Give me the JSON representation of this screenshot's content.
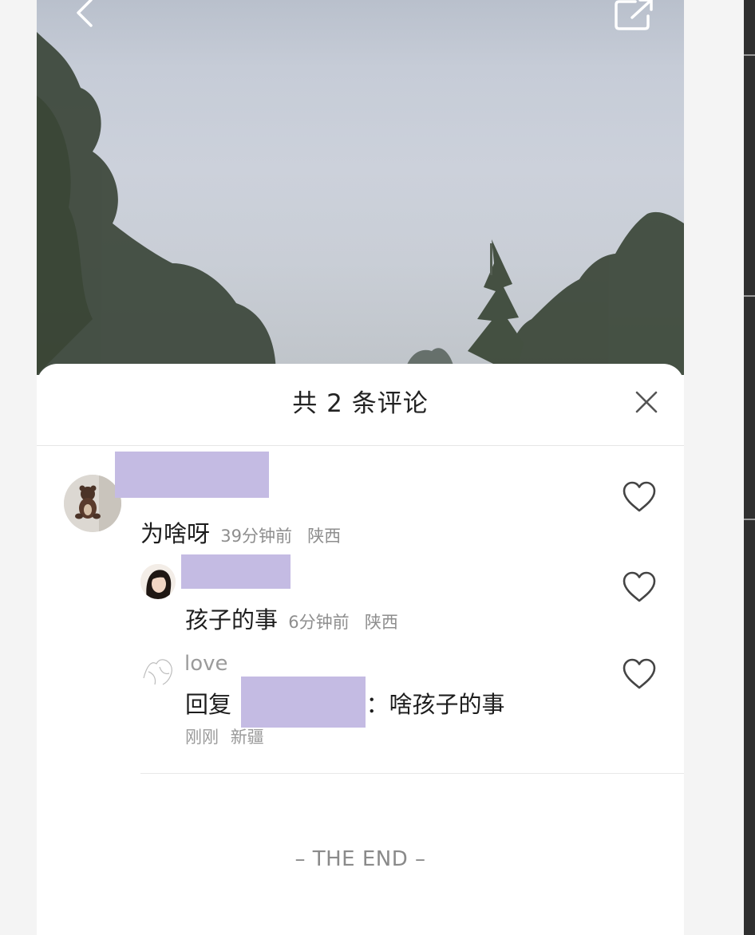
{
  "icons": {
    "back": "chevron-left-icon",
    "share": "share-external-icon",
    "close": "close-icon",
    "like": "heart-outline-icon"
  },
  "colors": {
    "redaction": "#c4bbe3",
    "text_primary": "#1d1d1d",
    "text_secondary": "#8e8e8e"
  },
  "comments_panel": {
    "title": "共 2 条评论",
    "end_label": "– THE END –"
  },
  "comments": [
    {
      "author": "",
      "text": "为啥呀",
      "time": "39分钟前",
      "location": "陕西",
      "replies": [
        {
          "author": "",
          "text": "孩子的事",
          "time": "6分钟前",
          "location": "陕西"
        },
        {
          "author": "love",
          "reply_prefix": "回复",
          "reply_suffix": "：啥孩子的事",
          "time": "刚刚",
          "location": "新疆"
        }
      ]
    }
  ]
}
